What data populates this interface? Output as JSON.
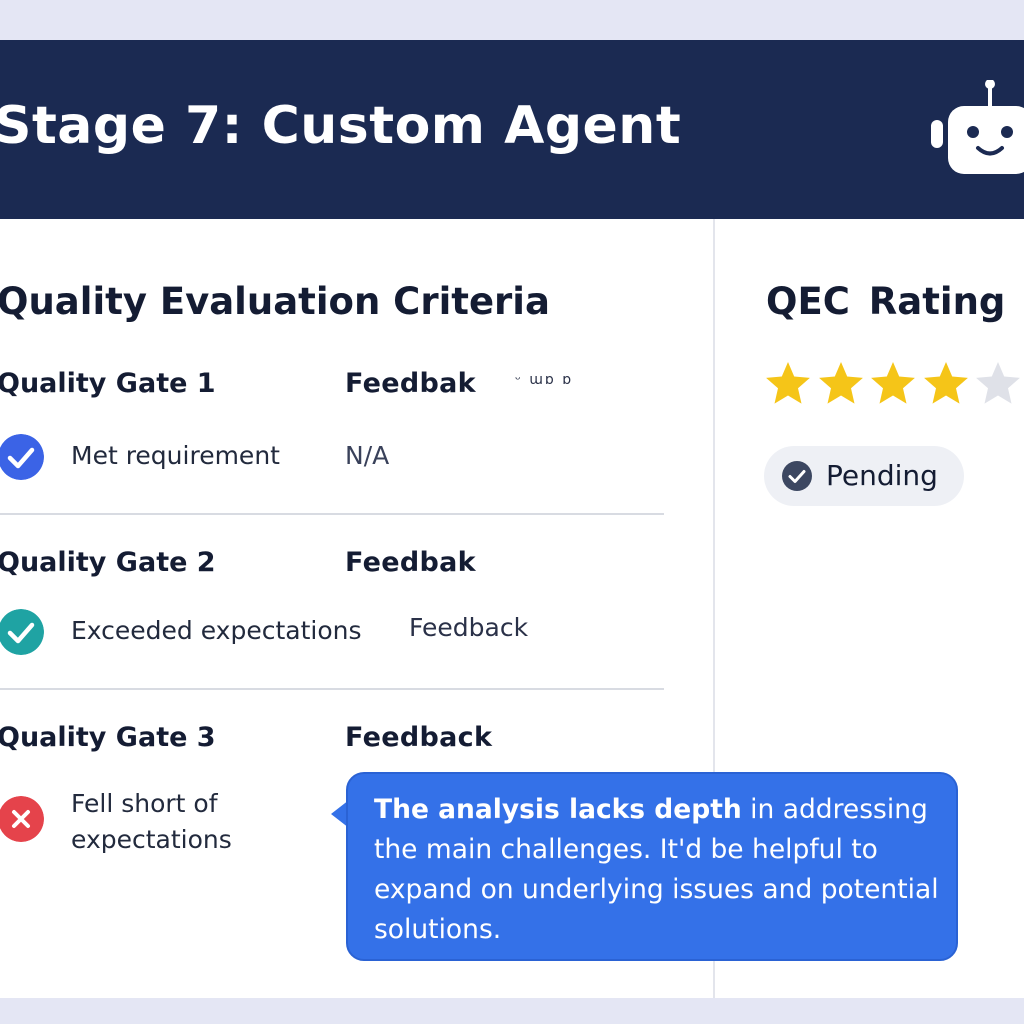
{
  "header": {
    "title": "Stage 7: Custom Agent"
  },
  "criteria": {
    "section_title": "Quality Evaluation Criteria",
    "gates": [
      {
        "title": "Quality Gate 1",
        "feedback_heading": "Feedbak",
        "status": "Met requirement",
        "feedback_value": "N/A"
      },
      {
        "title": "Quality Gate 2",
        "feedback_heading": "Feedbak",
        "status": "Exceeded expectations",
        "feedback_value": "Feedback"
      },
      {
        "title": "Quality Gate 3",
        "feedback_heading": "Feedback",
        "status_line1": "Fell short of",
        "status_line2": "expectations"
      }
    ],
    "stray_glyphs": "ᵕ ɯɒ ɒ"
  },
  "rating": {
    "title": "QEC  Rating",
    "stars_filled": 4,
    "stars_total": 5,
    "status_label": "Pending"
  },
  "feedback_bubble": {
    "lead": "The analysis lacks depth",
    "rest": " in addressing the main challenges. It'd be helpful to expand on underlying issues and potential solutions."
  },
  "colors": {
    "header_bg": "#1b2a52",
    "met_icon": "#3b63e6",
    "exceeded_icon": "#1fa3a3",
    "fell_short_icon": "#e5434b",
    "star_filled": "#f5c518",
    "star_empty": "#dfe1e8",
    "bubble_bg": "#3471e8"
  },
  "icons": {
    "header": "robot-icon",
    "met": "check-circle-icon",
    "exceeded": "check-circle-icon",
    "fell_short": "x-circle-icon",
    "pending": "check-circle-icon"
  }
}
